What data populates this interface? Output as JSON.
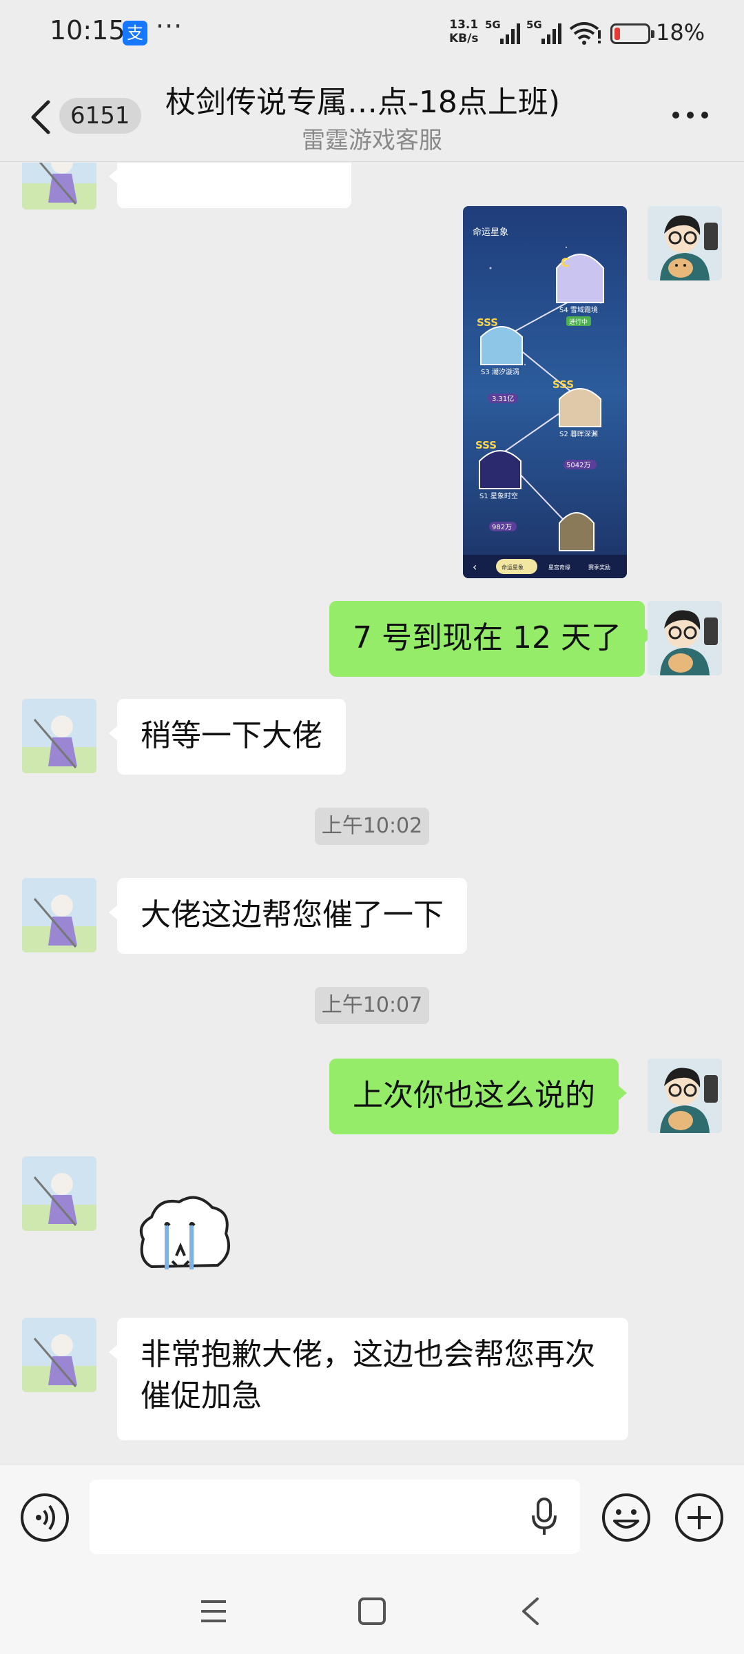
{
  "status_bar": {
    "time": "10:15",
    "app_badge": "支",
    "more": "···",
    "net_speed_value": "13.1",
    "net_speed_unit": "KB/s",
    "signal_1": "5G",
    "signal_2": "5G",
    "battery_percent": "18%",
    "battery_level": 0.18,
    "battery_color": "#e53935"
  },
  "header": {
    "unread_count": "6151",
    "title": "杖剑传说专属…点-18点上班)",
    "subtitle": "雷霆游戏客服"
  },
  "screenshot": {
    "heading": "命运星象",
    "badge_top": "C",
    "stages": [
      {
        "rank": "SSS",
        "name": "S3 潮汐漩涡",
        "amount": "3.31亿"
      },
      {
        "rank": "SSS",
        "name": "S2 暮晖深渊",
        "amount": "5042万"
      },
      {
        "rank": "SSS",
        "name": "S1 星象时空",
        "amount": "982万"
      }
    ],
    "top_stage": "S4 雪域霜境",
    "top_stage_status": "进行中",
    "bottom_tabs": [
      "命运星象",
      "星宫奇缘",
      "赛季奖励"
    ]
  },
  "messages": [
    {
      "id": "m1",
      "side": "out",
      "text": "7 号到现在 12 天了"
    },
    {
      "id": "m2",
      "side": "in",
      "text": "稍等一下大佬"
    },
    {
      "id": "t1",
      "text": "上午10:02"
    },
    {
      "id": "m3",
      "side": "in",
      "text": "大佬这边帮您催了一下"
    },
    {
      "id": "t2",
      "text": "上午10:07"
    },
    {
      "id": "m4",
      "side": "out",
      "text": "上次你也这么说的"
    },
    {
      "id": "m5",
      "side": "in",
      "text": "非常抱歉大佬，这边也会帮您再次催促加急"
    }
  ],
  "input_bar": {
    "placeholder": ""
  },
  "colors": {
    "background": "#ededed",
    "outgoing_bubble": "#95ec69",
    "incoming_bubble": "#ffffff",
    "timestamp_bg": "#dadada"
  }
}
